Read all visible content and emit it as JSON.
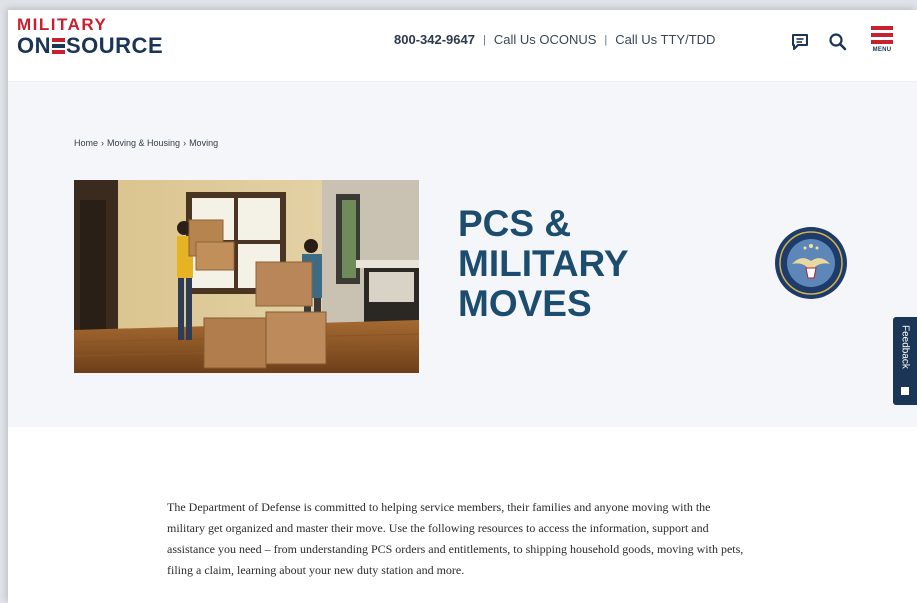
{
  "header": {
    "logo_top": "MILITARY",
    "logo_bottom_left": "ON",
    "logo_bottom_right": "SOURCE",
    "phone": "800-342-9647",
    "sep1": "|",
    "oconus": "Call Us OCONUS",
    "sep2": "|",
    "tty": "Call Us TTY/TDD",
    "menu_label": "MENU",
    "icons": [
      "chat-icon",
      "search-icon",
      "menu-icon"
    ]
  },
  "breadcrumb": {
    "items": [
      "Home",
      "Moving & Housing",
      "Moving"
    ],
    "separator": "›"
  },
  "hero": {
    "title_lines": [
      "PCS &",
      "MILITARY",
      "MOVES"
    ],
    "photo_alt": "photo of two people carrying moving boxes in an empty room",
    "seal_text": "DEPARTMENT OF DEFENSE · UNITED STATES OF AMERICA"
  },
  "feedback": {
    "label": "Feedback"
  },
  "intro": {
    "paragraph": "The Department of Defense is committed to helping service members, their families and anyone moving with the military get organized and master their move. Use the following resources to access the information, support and assistance you need – from understanding PCS orders and entitlements, to shipping household goods, moving with pets, filing a claim, learning about your new duty station and more."
  },
  "colors": {
    "brand_red": "#c8202f",
    "brand_navy": "#1b3557",
    "title_blue": "#1d4d6e",
    "hero_bg": "#f4f6f9"
  }
}
